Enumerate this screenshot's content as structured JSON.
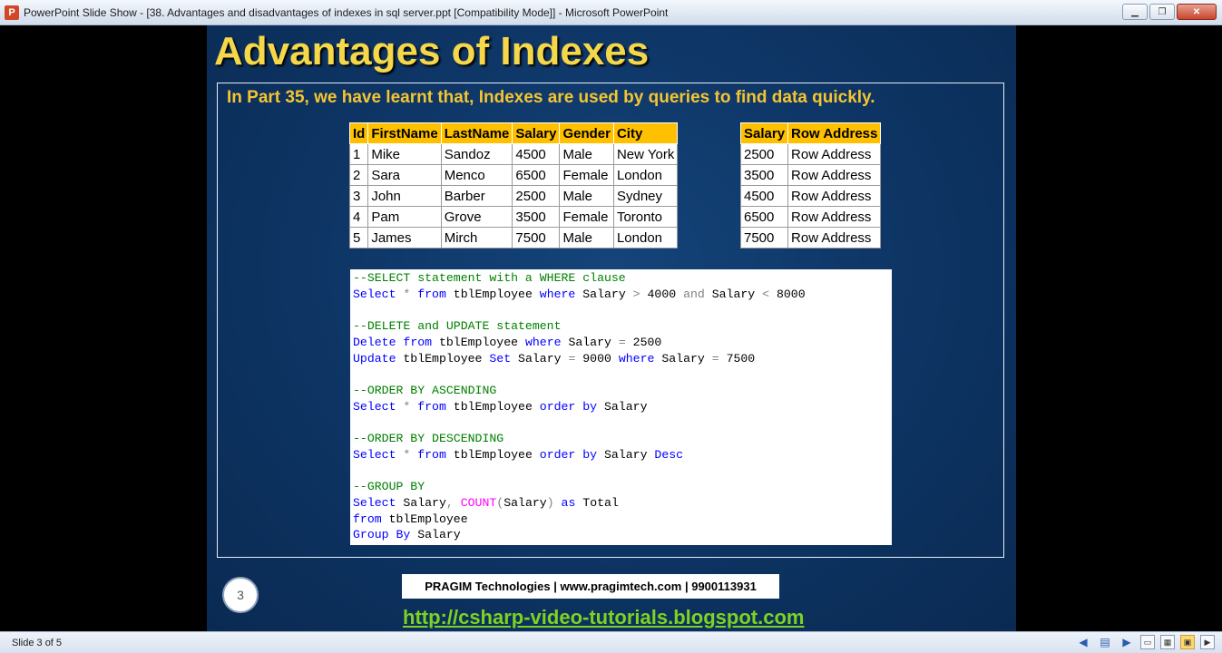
{
  "window": {
    "title": "PowerPoint Slide Show - [38. Advantages and disadvantages of indexes in sql server.ppt [Compatibility Mode]] - Microsoft PowerPoint",
    "app_icon_letter": "P",
    "minimize_glyph": "▁",
    "restore_glyph": "❐",
    "close_glyph": "✕"
  },
  "slide": {
    "title": "Advantages of Indexes",
    "intro": "In Part 35, we have learnt that, Indexes are used by queries to find data quickly.",
    "employee_table": {
      "headers": [
        "Id",
        "FirstName",
        "LastName",
        "Salary",
        "Gender",
        "City"
      ],
      "rows": [
        [
          "1",
          "Mike",
          "Sandoz",
          "4500",
          "Male",
          "New York"
        ],
        [
          "2",
          "Sara",
          "Menco",
          "6500",
          "Female",
          "London"
        ],
        [
          "3",
          "John",
          "Barber",
          "2500",
          "Male",
          "Sydney"
        ],
        [
          "4",
          "Pam",
          "Grove",
          "3500",
          "Female",
          "Toronto"
        ],
        [
          "5",
          "James",
          "Mirch",
          "7500",
          "Male",
          "London"
        ]
      ]
    },
    "index_table": {
      "headers": [
        "Salary",
        "Row Address"
      ],
      "rows": [
        [
          "2500",
          "Row Address"
        ],
        [
          "3500",
          "Row Address"
        ],
        [
          "4500",
          "Row Address"
        ],
        [
          "6500",
          "Row Address"
        ],
        [
          "7500",
          "Row Address"
        ]
      ]
    },
    "code_lines": [
      [
        [
          "c",
          "--SELECT statement with a WHERE clause"
        ]
      ],
      [
        [
          "k",
          "Select"
        ],
        [
          "g",
          " * "
        ],
        [
          "k",
          "from"
        ],
        [
          "",
          " tblEmployee "
        ],
        [
          "k",
          "where"
        ],
        [
          "",
          " Salary "
        ],
        [
          "g",
          ">"
        ],
        [
          "",
          " 4000 "
        ],
        [
          "g",
          "and"
        ],
        [
          "",
          " Salary "
        ],
        [
          "g",
          "<"
        ],
        [
          "",
          " 8000"
        ]
      ],
      [],
      [
        [
          "c",
          "--DELETE and UPDATE statement"
        ]
      ],
      [
        [
          "k",
          "Delete"
        ],
        [
          "",
          " "
        ],
        [
          "k",
          "from"
        ],
        [
          "",
          " tblEmployee "
        ],
        [
          "k",
          "where"
        ],
        [
          "",
          " Salary "
        ],
        [
          "g",
          "="
        ],
        [
          "",
          " 2500"
        ]
      ],
      [
        [
          "k",
          "Update"
        ],
        [
          "",
          " tblEmployee "
        ],
        [
          "k",
          "Set"
        ],
        [
          "",
          " Salary "
        ],
        [
          "g",
          "="
        ],
        [
          "",
          " 9000 "
        ],
        [
          "k",
          "where"
        ],
        [
          "",
          " Salary "
        ],
        [
          "g",
          "="
        ],
        [
          "",
          " 7500"
        ]
      ],
      [],
      [
        [
          "c",
          "--ORDER BY ASCENDING"
        ]
      ],
      [
        [
          "k",
          "Select"
        ],
        [
          "g",
          " * "
        ],
        [
          "k",
          "from"
        ],
        [
          "",
          " tblEmployee "
        ],
        [
          "k",
          "order by"
        ],
        [
          "",
          " Salary"
        ]
      ],
      [],
      [
        [
          "c",
          "--ORDER BY DESCENDING"
        ]
      ],
      [
        [
          "k",
          "Select"
        ],
        [
          "g",
          " * "
        ],
        [
          "k",
          "from"
        ],
        [
          "",
          " tblEmployee "
        ],
        [
          "k",
          "order by"
        ],
        [
          "",
          " Salary "
        ],
        [
          "k",
          "Desc"
        ]
      ],
      [],
      [
        [
          "c",
          "--GROUP BY"
        ]
      ],
      [
        [
          "k",
          "Select"
        ],
        [
          "",
          " Salary"
        ],
        [
          "g",
          ", "
        ],
        [
          "f",
          "COUNT"
        ],
        [
          "g",
          "("
        ],
        [
          "",
          "Salary"
        ],
        [
          "g",
          ")"
        ],
        [
          "",
          " "
        ],
        [
          "k",
          "as"
        ],
        [
          "",
          " Total"
        ]
      ],
      [
        [
          "k",
          "from"
        ],
        [
          "",
          " tblEmployee"
        ]
      ],
      [
        [
          "k",
          "Group By"
        ],
        [
          "",
          " Salary"
        ]
      ]
    ],
    "slide_number": "3",
    "footer_company": "PRAGIM Technologies | www.pragimtech.com | 9900113931",
    "footer_link": "http://csharp-video-tutorials.blogspot.com"
  },
  "statusbar": {
    "slide_count": "Slide 3 of 5",
    "prev_glyph": "◀",
    "menu_glyph": "▤",
    "next_glyph": "▶",
    "normal_view_glyph": "▭",
    "sorter_view_glyph": "▦",
    "reading_view_glyph": "▣",
    "slideshow_view_glyph": "▶"
  }
}
